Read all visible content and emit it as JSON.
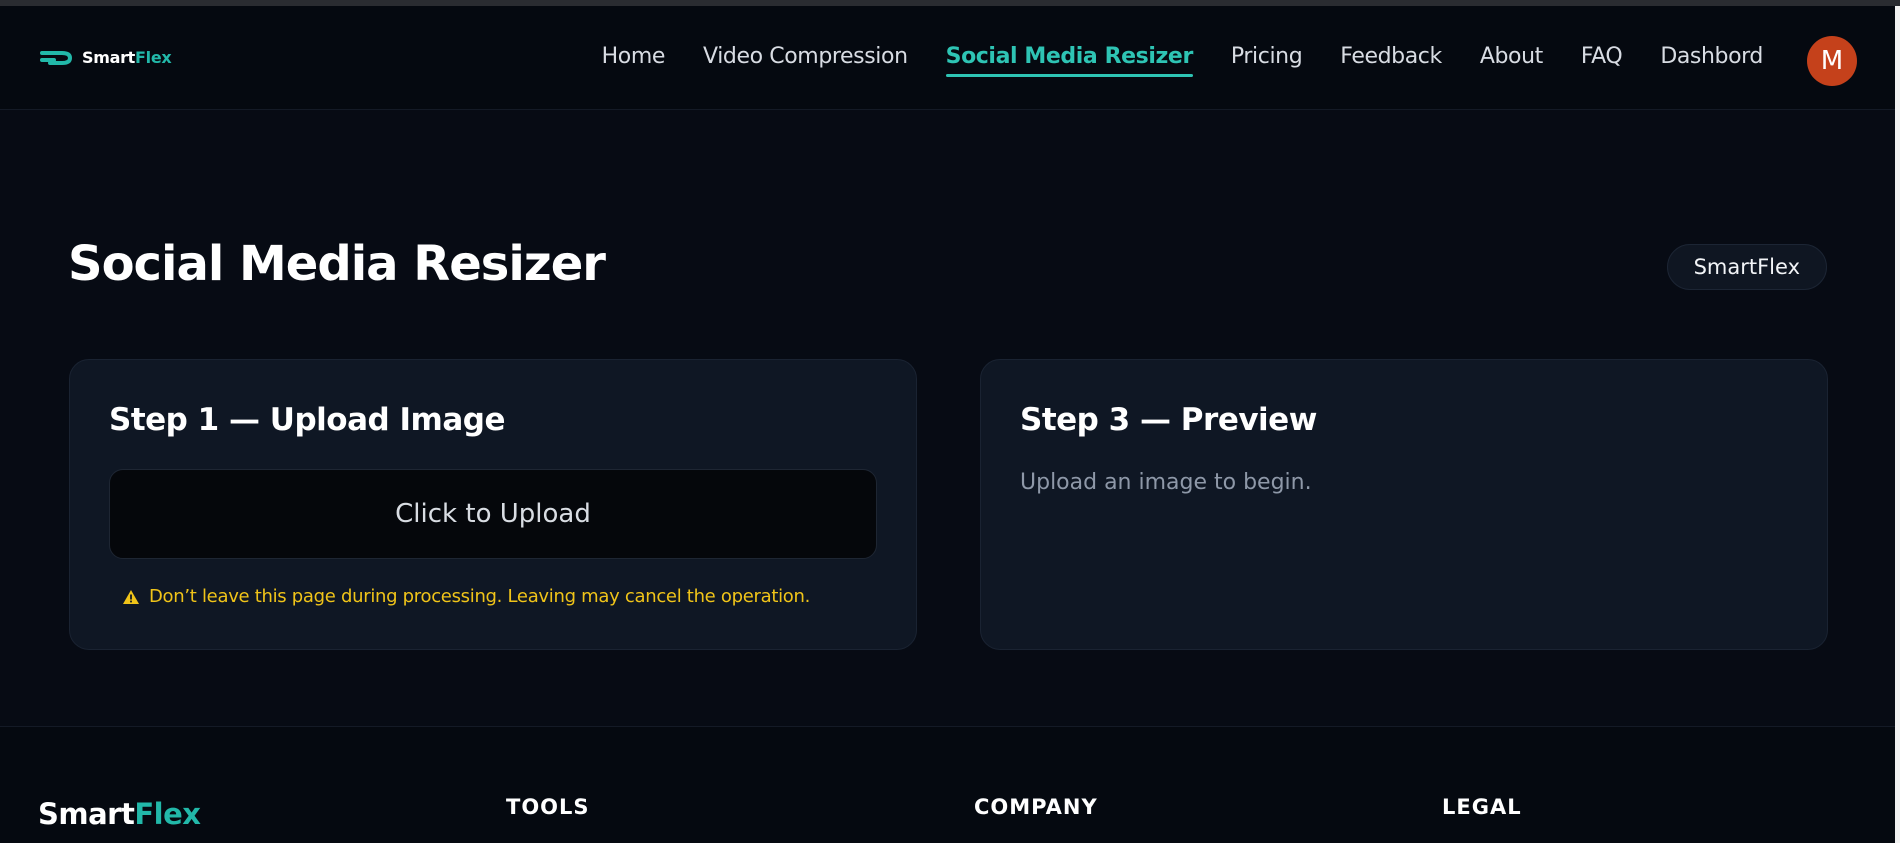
{
  "brand": {
    "name_part1": "Smart",
    "name_part2": "Flex",
    "accent_color": "#22b8a9"
  },
  "nav": {
    "links": [
      {
        "label": "Home",
        "active": false
      },
      {
        "label": "Video Compression",
        "active": false
      },
      {
        "label": "Social Media Resizer",
        "active": true
      },
      {
        "label": "Pricing",
        "active": false
      },
      {
        "label": "Feedback",
        "active": false
      },
      {
        "label": "About",
        "active": false
      },
      {
        "label": "FAQ",
        "active": false
      },
      {
        "label": "Dashbord",
        "active": false
      }
    ],
    "avatar_initial": "M",
    "avatar_color": "#c5411b"
  },
  "main": {
    "title": "Social Media Resizer",
    "brand_pill": "SmartFlex",
    "upload_card": {
      "title": "Step 1 — Upload Image",
      "upload_button": "Click to Upload",
      "warning": "Don’t leave this page during processing. Leaving may cancel the operation."
    },
    "preview_card": {
      "title": "Step 3 — Preview",
      "hint": "Upload an image to begin."
    }
  },
  "footer": {
    "logo_part1": "Smart",
    "logo_part2": "Flex",
    "headings": [
      "TOOLS",
      "COMPANY",
      "LEGAL"
    ]
  }
}
